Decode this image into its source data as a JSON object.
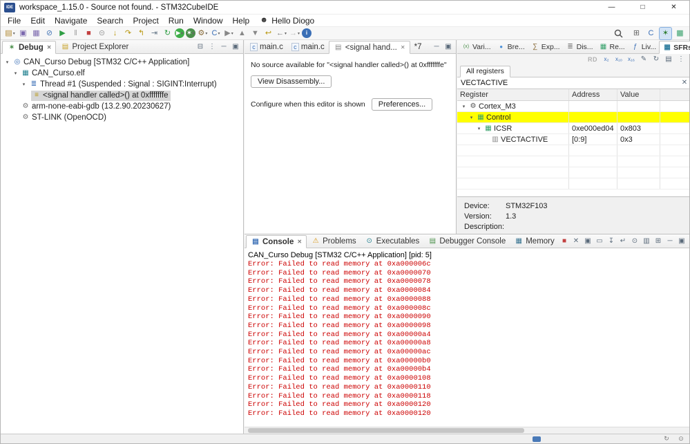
{
  "window": {
    "title": "workspace_1.15.0 - Source not found. - STM32CubeIDE"
  },
  "menu": {
    "items": [
      "File",
      "Edit",
      "Navigate",
      "Search",
      "Project",
      "Run",
      "Window",
      "Help"
    ],
    "user_label": "Hello Diogo"
  },
  "toolbar": {
    "icons": [
      {
        "name": "new-wizard-icon",
        "glyph": "▤",
        "color": "#b08830",
        "dropdown": true
      },
      {
        "name": "save-icon",
        "glyph": "▣",
        "color": "#7b68ae"
      },
      {
        "name": "save-all-icon",
        "glyph": "▦",
        "color": "#7b68ae"
      },
      {
        "name": "skip-all-breakpoints-icon",
        "glyph": "⊘",
        "color": "#4a7ab8"
      },
      {
        "name": "resume-icon",
        "glyph": "▶",
        "color": "#2f9e44"
      },
      {
        "name": "suspend-icon",
        "glyph": "‖",
        "color": "#a0a0a0"
      },
      {
        "name": "terminate-icon",
        "glyph": "■",
        "color": "#c24040"
      },
      {
        "name": "disconnect-icon",
        "glyph": "⊝",
        "color": "#9a9a9a"
      },
      {
        "name": "step-into-icon",
        "glyph": "↓",
        "color": "#b8960b"
      },
      {
        "name": "step-over-icon",
        "glyph": "↷",
        "color": "#b8960b"
      },
      {
        "name": "step-return-icon",
        "glyph": "↰",
        "color": "#b8960b"
      },
      {
        "name": "instruction-stepping-icon",
        "glyph": "⇥",
        "color": "#667788"
      },
      {
        "name": "restart-icon",
        "glyph": "↻",
        "color": "#2f9e44"
      },
      {
        "name": "run-icon",
        "glyph": "▶",
        "color": "#ffffff",
        "bg": "#3fae49",
        "dropdown": true
      },
      {
        "name": "debug-icon",
        "glyph": "✶",
        "color": "#ffffff",
        "bg": "#4a8f4a",
        "dropdown": true
      },
      {
        "name": "build-icon",
        "glyph": "⚙",
        "color": "#8a6d3b",
        "dropdown": true
      },
      {
        "name": "new-project-icon",
        "glyph": "C",
        "color": "#3b6fb6",
        "dropdown": true
      },
      {
        "name": "external-tools-icon",
        "glyph": "▶",
        "color": "#888888",
        "dropdown": true
      },
      {
        "name": "previous-annotation-icon",
        "glyph": "▲",
        "color": "#888888"
      },
      {
        "name": "next-annotation-icon",
        "glyph": "▼",
        "color": "#888888"
      },
      {
        "name": "last-edit-location-icon",
        "glyph": "↩",
        "color": "#b8960b"
      },
      {
        "name": "back-icon",
        "glyph": "←",
        "color": "#777777",
        "dropdown": true
      },
      {
        "name": "forward-icon",
        "glyph": "→",
        "color": "#bbbbbb",
        "dropdown": true
      },
      {
        "name": "info-icon",
        "glyph": "i",
        "color": "#ffffff",
        "bg": "#3b6fb6"
      }
    ]
  },
  "perspective_bar": {
    "icons": [
      {
        "name": "open-perspective-icon",
        "glyph": "⊞",
        "color": "#666666"
      },
      {
        "name": "cpp-perspective-icon",
        "glyph": "C",
        "color": "#3b6fb6"
      },
      {
        "name": "debug-perspective-icon",
        "glyph": "✶",
        "color": "#2f7d2f",
        "active": true
      },
      {
        "name": "device-config-perspective-icon",
        "glyph": "▦",
        "color": "#35a06a"
      }
    ]
  },
  "debug_panel": {
    "tabs": [
      {
        "label": "Debug",
        "selected": true
      },
      {
        "label": "Project Explorer",
        "selected": false
      }
    ],
    "tree": [
      {
        "label": "CAN_Curso Debug [STM32 C/C++ Application]",
        "level": 0
      },
      {
        "label": "CAN_Curso.elf",
        "level": 1
      },
      {
        "label": "Thread #1 (Suspended : Signal : SIGINT:Interrupt)",
        "level": 2
      },
      {
        "label": "<signal handler called>() at 0xfffffffe",
        "level": 3,
        "selected": true
      },
      {
        "label": "arm-none-eabi-gdb (13.2.90.20230627)",
        "level": 1
      },
      {
        "label": "ST-LINK (OpenOCD)",
        "level": 1
      }
    ]
  },
  "editor": {
    "tabs": [
      {
        "label": "main.c",
        "selected": false
      },
      {
        "label": "main.c",
        "selected": false
      },
      {
        "label": "<signal hand...",
        "selected": true
      },
      {
        "label": "*7",
        "selected": false
      }
    ],
    "no_source_message": "No source available for \"<signal handler called>() at 0xfffffffe\"",
    "view_disassembly_button": "View Disassembly...",
    "configure_text": "Configure when this editor is shown",
    "preferences_button": "Preferences..."
  },
  "sfrs_panel": {
    "tabs": [
      {
        "label": "Vari..."
      },
      {
        "label": "Bre..."
      },
      {
        "label": "Exp..."
      },
      {
        "label": "Dis..."
      },
      {
        "label": "Re..."
      },
      {
        "label": "Liv..."
      },
      {
        "label": "SFRs",
        "selected": true
      }
    ],
    "rd_label": "RD",
    "all_registers_tab": "All registers",
    "filter_value": "VECTACTIVE",
    "columns": [
      "Register",
      "Address",
      "Value"
    ],
    "rows": [
      {
        "register": "Cortex_M3",
        "address": "",
        "value": "",
        "level": 0
      },
      {
        "register": "Control",
        "address": "",
        "value": "",
        "level": 1,
        "highlighted": true
      },
      {
        "register": "ICSR",
        "address": "0xe000ed04",
        "value": "0x803",
        "level": 2
      },
      {
        "register": "VECTACTIVE",
        "address": "[0:9]",
        "value": "0x3",
        "level": 3
      }
    ],
    "info": {
      "device_label": "Device:",
      "device_value": "STM32F103",
      "version_label": "Version:",
      "version_value": "1.3",
      "description_label": "Description:"
    }
  },
  "console_panel": {
    "tabs": [
      {
        "label": "Console",
        "selected": true
      },
      {
        "label": "Problems"
      },
      {
        "label": "Executables"
      },
      {
        "label": "Debugger Console"
      },
      {
        "label": "Memory"
      }
    ],
    "process_label": "CAN_Curso Debug [STM32 C/C++ Application] [pid: 5]",
    "error_lines": [
      "Error: Failed to read memory at 0xa000006c",
      "Error: Failed to read memory at 0xa0000070",
      "Error: Failed to read memory at 0xa0000078",
      "Error: Failed to read memory at 0xa0000084",
      "Error: Failed to read memory at 0xa0000088",
      "Error: Failed to read memory at 0xa000008c",
      "Error: Failed to read memory at 0xa0000090",
      "Error: Failed to read memory at 0xa0000098",
      "Error: Failed to read memory at 0xa00000a4",
      "Error: Failed to read memory at 0xa00000a8",
      "Error: Failed to read memory at 0xa00000ac",
      "Error: Failed to read memory at 0xa00000b0",
      "Error: Failed to read memory at 0xa00000b4",
      "Error: Failed to read memory at 0xa0000108",
      "Error: Failed to read memory at 0xa0000110",
      "Error: Failed to read memory at 0xa0000118",
      "Error: Failed to read memory at 0xa0000120",
      "Error: Failed to read memory at 0xa0000120"
    ]
  },
  "colors": {
    "row_highlight": "#ffff00",
    "error_text": "#cc0000",
    "selection": "#d6d6d6",
    "accent": "#3b6fb6"
  },
  "icons": {
    "app": "IDE",
    "user": "☻",
    "window-minimize": "—",
    "window-maximize": "□",
    "window-close": "✕",
    "bug": "✶",
    "folder": "▤",
    "close": "✕",
    "collapse-all": "⊟",
    "view-menu": "⋮",
    "minimize": "─",
    "maximize": "▣",
    "expander": "▾",
    "c-file": "c",
    "no-source-file": "▤",
    "debug-target": "◎",
    "elf": "▦",
    "thread": "≣",
    "stack-frame": "≡",
    "gear": "⚙",
    "variables": "(x)",
    "breakpoints": "●",
    "expressions": "∑",
    "disassembly": "≣",
    "registers": "▦",
    "live-expressions": "ƒ",
    "sfrs": "▦",
    "core": "◉",
    "register-grid": "▦",
    "bitfield": "▥",
    "filter-clear": "✕",
    "format-bin": "x₂",
    "format-dec": "x₁₀",
    "format-hex": "x₁₆",
    "modify": "✎",
    "refresh": "↻",
    "export": "▤",
    "console-tab": "▤",
    "problems": "⚠",
    "executables": "⊙",
    "debugger-console": "▤",
    "memory": "▦",
    "terminate": "■",
    "remove-launch": "✕",
    "remove-all": "▣",
    "pin": "⊙",
    "scroll-lock": "↧",
    "word-wrap": "↵",
    "clear-console": "▭",
    "display-console": "▥",
    "open-console": "⊞",
    "progress": "↻",
    "notifications": "⊙"
  }
}
